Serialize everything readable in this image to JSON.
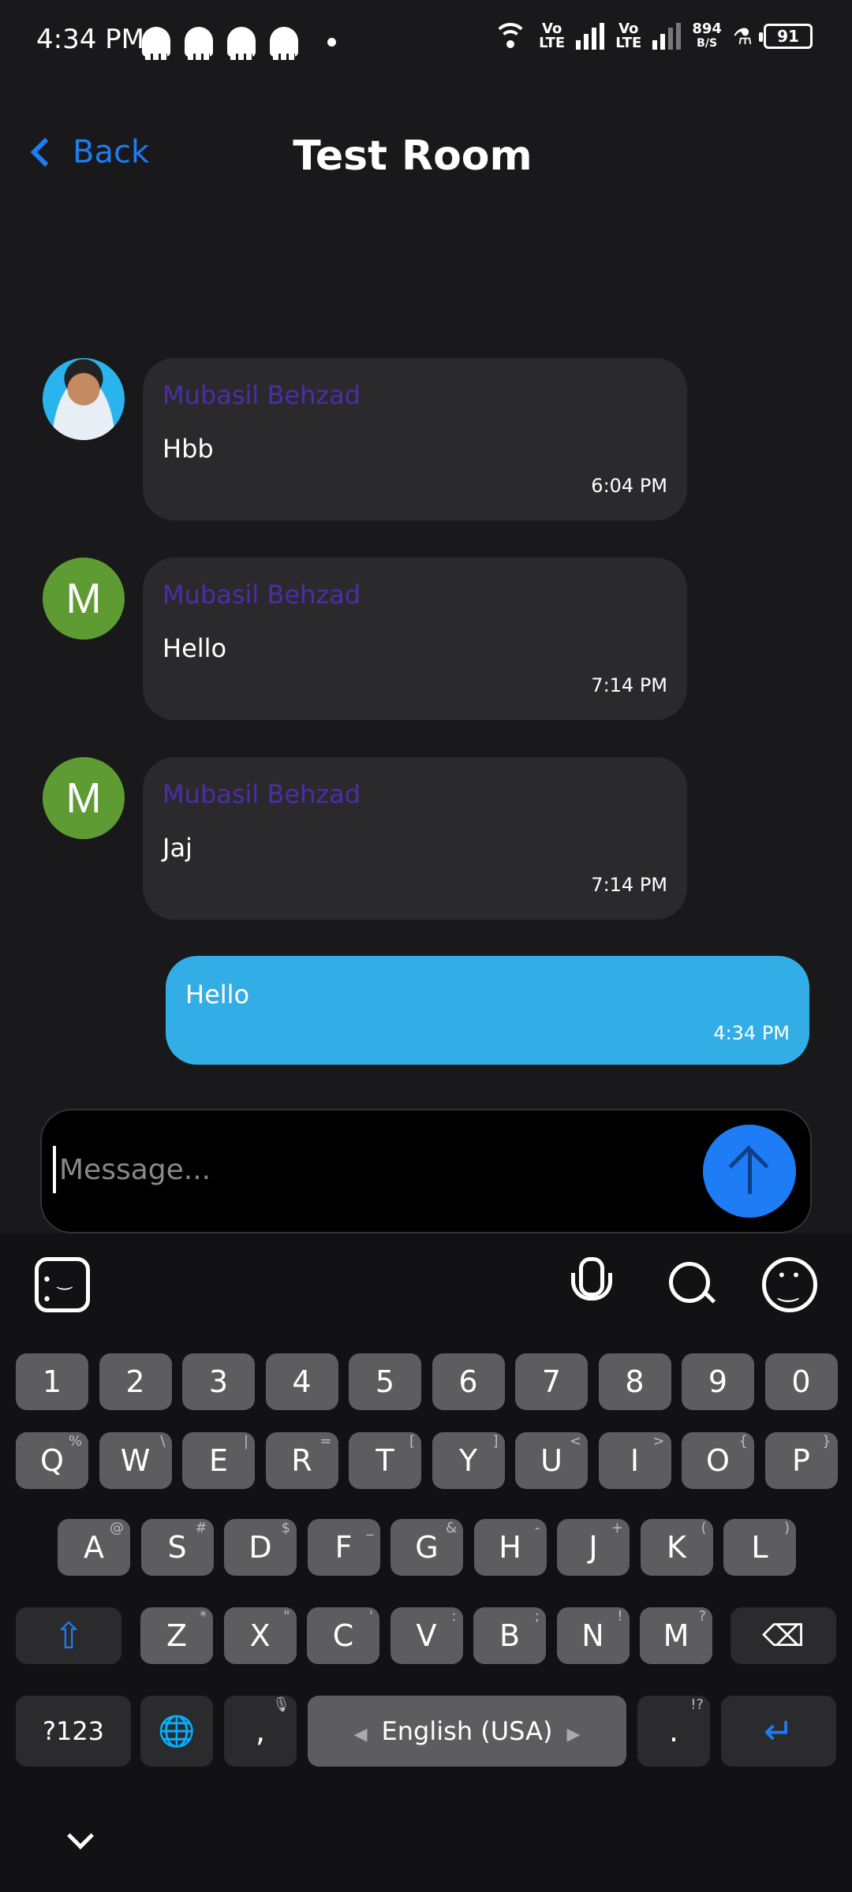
{
  "status_bar": {
    "time": "4:34 PM",
    "net_1_top": "Vo",
    "net_1_bottom": "LTE",
    "net_2_top": "Vo",
    "net_2_bottom": "LTE",
    "speed_top": "894",
    "speed_bottom": "B/S",
    "battery": "91",
    "icons": [
      "snapchat-ghost-icon",
      "snapchat-ghost-icon",
      "snapchat-ghost-icon",
      "snapchat-ghost-icon",
      "dot-icon",
      "wifi-icon",
      "signal-icon",
      "signal-icon",
      "flask-icon",
      "battery-icon"
    ]
  },
  "header": {
    "back_label": "Back",
    "title": "Test Room"
  },
  "messages": [
    {
      "sender": "Mubasil Behzad",
      "text": "Hbb",
      "time": "6:04 PM",
      "avatar": "photo"
    },
    {
      "sender": "Mubasil Behzad",
      "text": "Hello",
      "time": "7:14 PM",
      "avatar": "M"
    },
    {
      "sender": "Mubasil Behzad",
      "text": "Jaj",
      "time": "7:14 PM",
      "avatar": "M"
    }
  ],
  "my_message": {
    "text": "Hello",
    "time": "4:34 PM"
  },
  "composer": {
    "placeholder": "Message...",
    "value": ""
  },
  "keyboard": {
    "row_numbers": [
      "1",
      "2",
      "3",
      "4",
      "5",
      "6",
      "7",
      "8",
      "9",
      "0"
    ],
    "row_q": [
      {
        "k": "Q",
        "s": "%"
      },
      {
        "k": "W",
        "s": "\\"
      },
      {
        "k": "E",
        "s": "|"
      },
      {
        "k": "R",
        "s": "="
      },
      {
        "k": "T",
        "s": "["
      },
      {
        "k": "Y",
        "s": "]"
      },
      {
        "k": "U",
        "s": "<"
      },
      {
        "k": "I",
        "s": ">"
      },
      {
        "k": "O",
        "s": "{"
      },
      {
        "k": "P",
        "s": "}"
      }
    ],
    "row_a": [
      {
        "k": "A",
        "s": "@"
      },
      {
        "k": "S",
        "s": "#"
      },
      {
        "k": "D",
        "s": "$"
      },
      {
        "k": "F",
        "s": "_"
      },
      {
        "k": "G",
        "s": "&"
      },
      {
        "k": "H",
        "s": "-"
      },
      {
        "k": "J",
        "s": "+"
      },
      {
        "k": "K",
        "s": "("
      },
      {
        "k": "L",
        "s": ")"
      }
    ],
    "row_z": [
      {
        "k": "Z",
        "s": "*"
      },
      {
        "k": "X",
        "s": "\""
      },
      {
        "k": "C",
        "s": "'"
      },
      {
        "k": "V",
        "s": ":"
      },
      {
        "k": "B",
        "s": ";"
      },
      {
        "k": "N",
        "s": "!"
      },
      {
        "k": "M",
        "s": "?"
      }
    ],
    "sym_label": "?123",
    "comma": ",",
    "space_label": "English (USA)",
    "period": ".",
    "period_sup": "!?"
  },
  "colors": {
    "background": "#19191b",
    "accent": "#1e7cf5",
    "bubble_other": "#2a2a2c",
    "bubble_mine": "#33ade6",
    "sender_name": "#4b2ea8",
    "avatar_letter_bg": "#5e9c33"
  }
}
